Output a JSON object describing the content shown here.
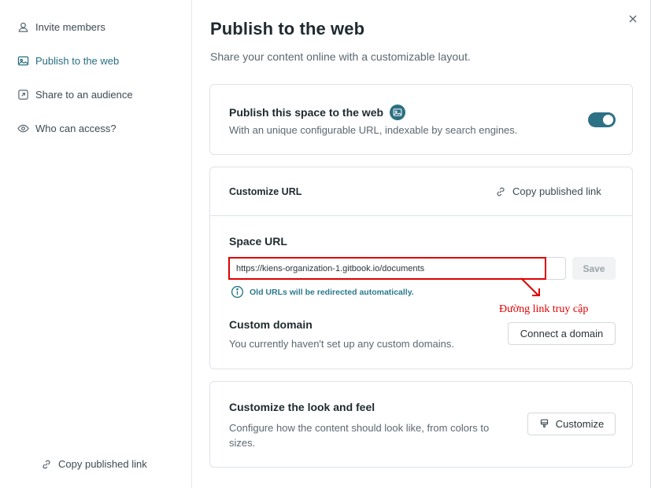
{
  "sidebar": {
    "items": [
      {
        "label": "Invite members",
        "icon": "user-icon"
      },
      {
        "label": "Publish to the web",
        "icon": "web-icon",
        "active": true
      },
      {
        "label": "Share to an audience",
        "icon": "share-icon"
      },
      {
        "label": "Who can access?",
        "icon": "eye-icon"
      }
    ],
    "footer_label": "Copy published link"
  },
  "header": {
    "title": "Publish to the web",
    "subtitle": "Share your content online with a customizable layout."
  },
  "publish_card": {
    "title": "Publish this space to the web",
    "description": "With an unique configurable URL, indexable by search engines.",
    "toggle_on": true
  },
  "url_card": {
    "header_title": "Customize URL",
    "copy_link_label": "Copy published link",
    "space_url_label": "Space URL",
    "space_url_value": "https://kiens-organization-1.gitbook.io/documents",
    "save_label": "Save",
    "redirect_note": "Old URLs will be redirected automatically.",
    "custom_domain_title": "Custom domain",
    "custom_domain_desc": "You currently haven't set up any custom domains.",
    "connect_domain_label": "Connect a domain",
    "annotation": "Đường link truy cập"
  },
  "look_card": {
    "title": "Customize the look and feel",
    "description": "Configure how the content should look like, from colors to sizes.",
    "button_label": "Customize"
  },
  "colors": {
    "accent": "#2d7185",
    "annotation": "#e00000"
  }
}
